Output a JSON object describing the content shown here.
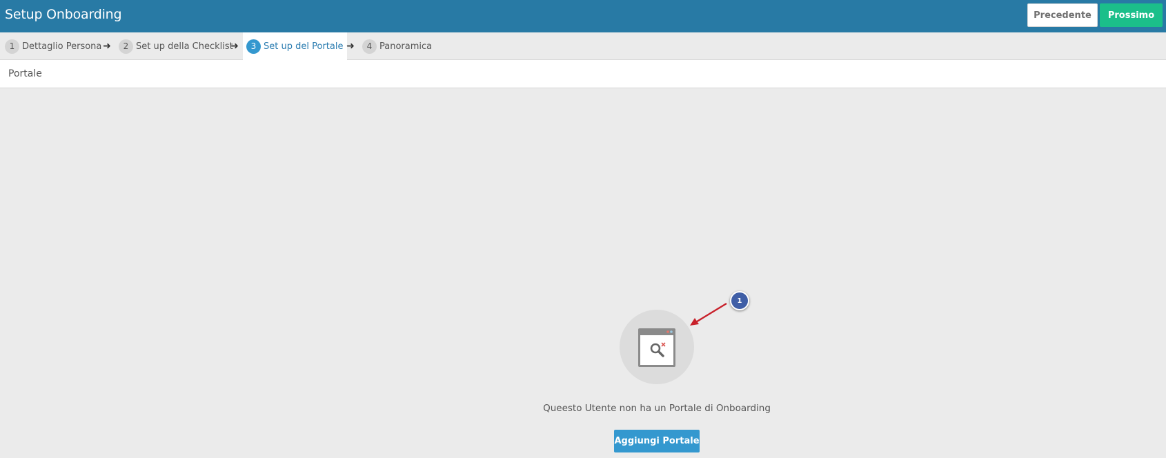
{
  "header": {
    "title": "Setup Onboarding",
    "prev_label": "Precedente",
    "next_label": "Prossimo"
  },
  "steps": [
    {
      "num": "1",
      "label": "Dettaglio Persona"
    },
    {
      "num": "2",
      "label": "Set up della Checklist"
    },
    {
      "num": "3",
      "label": "Set up del Portale"
    },
    {
      "num": "4",
      "label": "Panoramica"
    }
  ],
  "active_step": 3,
  "section": {
    "title": "Portale"
  },
  "empty_state": {
    "icon": "browser-search-icon",
    "message": "Queesto Utente non ha un Portale di Onboarding",
    "button_label": "Aggiungi Portale"
  },
  "annotation": {
    "number": "1"
  },
  "colors": {
    "topbar": "#287aa5",
    "next_button": "#1bbf8a",
    "active_step": "#3498cf",
    "add_button": "#3498cf",
    "callout": "#3f5ea6",
    "callout_arrow": "#c8202a"
  }
}
